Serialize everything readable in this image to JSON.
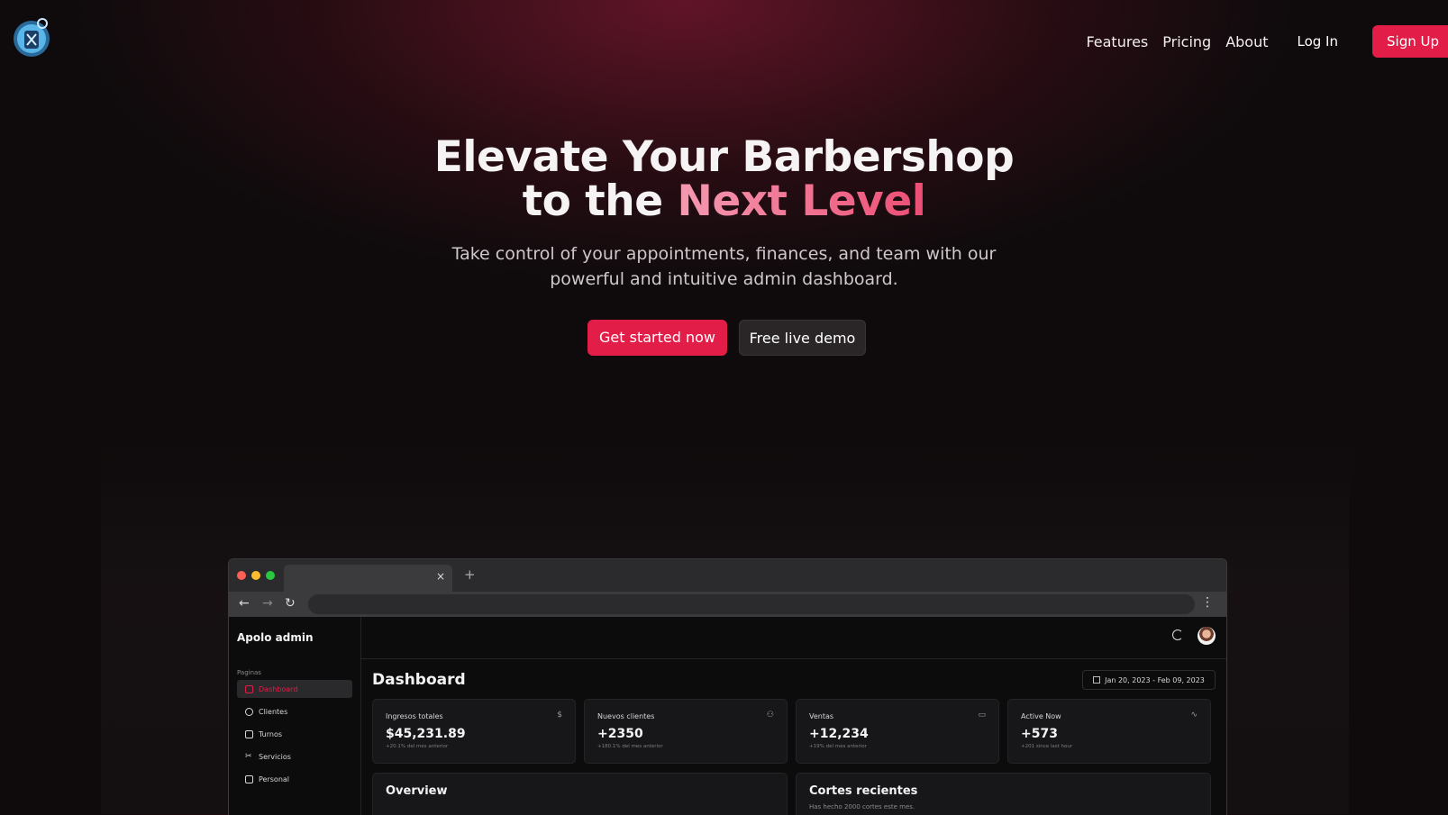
{
  "nav": {
    "links": [
      "Features",
      "Pricing",
      "About"
    ],
    "login": "Log In",
    "signup": "Sign Up"
  },
  "hero": {
    "title_line1": "Elevate Your Barbershop",
    "title_line2_plain": "to the",
    "title_line2_accent": "Next Level",
    "subtitle_line1": "Take control of your appointments, finances, and team with our",
    "subtitle_line2": "powerful and intuitive admin dashboard.",
    "cta_primary": "Get started now",
    "cta_secondary": "Free live demo"
  },
  "colors": {
    "accent": "#e11d48",
    "background": "#0f0b0c"
  },
  "browser": {
    "tab_close": "×",
    "new_tab": "+"
  },
  "app": {
    "title": "Apolo admin",
    "section_label": "Paginas",
    "sidebar": [
      {
        "label": "Dashboard",
        "active": true
      },
      {
        "label": "Clientes"
      },
      {
        "label": "Turnos"
      },
      {
        "label": "Servicios"
      },
      {
        "label": "Personal"
      }
    ],
    "page_title": "Dashboard",
    "date_range": "Jan 20, 2023 - Feb 09, 2023",
    "cards": [
      {
        "title": "Ingresos totales",
        "icon": "$",
        "value": "$45,231.89",
        "sub": "+20.1% del mes anterior"
      },
      {
        "title": "Nuevos clientes",
        "icon": "users-icon",
        "value": "+2350",
        "sub": "+180.1% del mes anterior"
      },
      {
        "title": "Ventas",
        "icon": "credit-card-icon",
        "value": "+12,234",
        "sub": "+19% del mes anterior"
      },
      {
        "title": "Active Now",
        "icon": "activity-icon",
        "value": "+573",
        "sub": "+201 since last hour"
      }
    ],
    "overview": {
      "title": "Overview"
    },
    "recent": {
      "title": "Cortes recientes",
      "subtitle": "Has hecho 2000 cortes este mes."
    }
  }
}
